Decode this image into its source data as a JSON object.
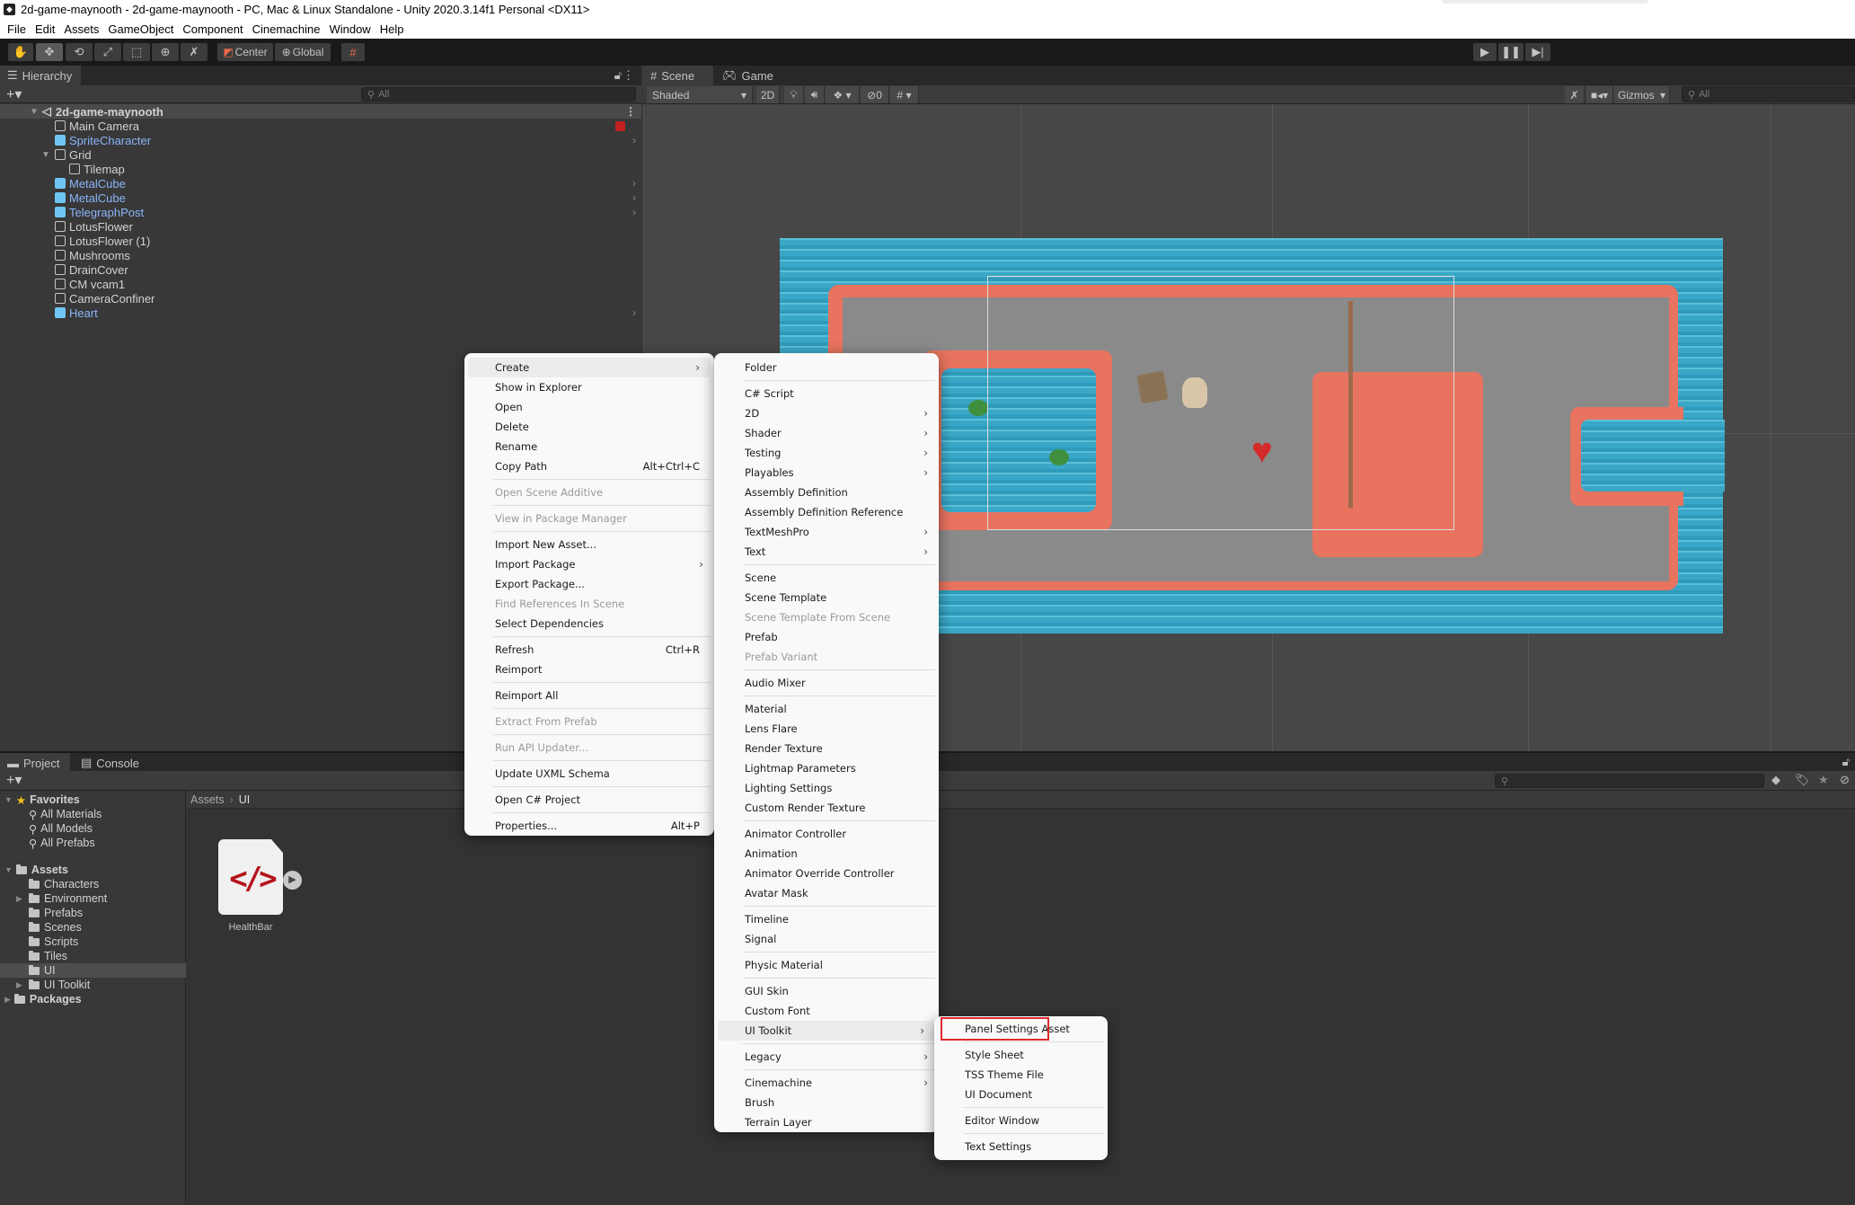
{
  "window": {
    "title": "2d-game-maynooth - 2d-game-maynooth - PC, Mac & Linux Standalone - Unity 2020.3.14f1 Personal <DX11>"
  },
  "menubar": [
    "File",
    "Edit",
    "Assets",
    "GameObject",
    "Component",
    "Cinemachine",
    "Window",
    "Help"
  ],
  "toolbar": {
    "tools": [
      "hand-tool",
      "move-tool",
      "rotate-tool",
      "scale-tool",
      "rect-tool",
      "transform-tool",
      "custom-tool"
    ],
    "pivot_label": "Center",
    "space_label": "Global",
    "snap": "grid-snap",
    "play": "play",
    "pause": "pause",
    "step": "step"
  },
  "hierarchy": {
    "tab_label": "Hierarchy",
    "search_placeholder": "All",
    "scene_name": "2d-game-maynooth",
    "items": [
      {
        "label": "Main Camera",
        "prefab": false,
        "depth": 1
      },
      {
        "label": "SpriteCharacter",
        "prefab": true,
        "depth": 1,
        "has_children": true
      },
      {
        "label": "Grid",
        "prefab": false,
        "depth": 1,
        "expanded": true
      },
      {
        "label": "Tilemap",
        "prefab": false,
        "depth": 2
      },
      {
        "label": "MetalCube",
        "prefab": true,
        "depth": 1,
        "has_children": true
      },
      {
        "label": "MetalCube",
        "prefab": true,
        "depth": 1,
        "has_children": true
      },
      {
        "label": "TelegraphPost",
        "prefab": true,
        "depth": 1,
        "has_children": true
      },
      {
        "label": "LotusFlower",
        "prefab": false,
        "depth": 1
      },
      {
        "label": "LotusFlower (1)",
        "prefab": false,
        "depth": 1
      },
      {
        "label": "Mushrooms",
        "prefab": false,
        "depth": 1
      },
      {
        "label": "DrainCover",
        "prefab": false,
        "depth": 1
      },
      {
        "label": "CM vcam1",
        "prefab": false,
        "depth": 1
      },
      {
        "label": "CameraConfiner",
        "prefab": false,
        "depth": 1
      },
      {
        "label": "Heart",
        "prefab": true,
        "depth": 1,
        "has_children": true
      }
    ]
  },
  "scene_view": {
    "tabs": [
      {
        "label": "Scene",
        "icon": "grid-icon"
      },
      {
        "label": "Game",
        "icon": "gamepad-icon"
      }
    ],
    "shading_mode": "Shaded",
    "mode_2d_label": "2D",
    "hidden_count": "0",
    "gizmos_label": "Gizmos",
    "search_placeholder": "All"
  },
  "project": {
    "tabs": [
      {
        "label": "Project",
        "icon": "folder-icon"
      },
      {
        "label": "Console",
        "icon": "console-icon"
      }
    ],
    "favorites_label": "Favorites",
    "favorites": [
      "All Materials",
      "All Models",
      "All Prefabs"
    ],
    "assets_label": "Assets",
    "folders": [
      {
        "label": "Characters",
        "expandable": false
      },
      {
        "label": "Environment",
        "expandable": true
      },
      {
        "label": "Prefabs",
        "expandable": false
      },
      {
        "label": "Scenes",
        "expandable": false
      },
      {
        "label": "Scripts",
        "expandable": false
      },
      {
        "label": "Tiles",
        "expandable": false
      },
      {
        "label": "UI",
        "expandable": false,
        "selected": true
      },
      {
        "label": "UI Toolkit",
        "expandable": true
      }
    ],
    "packages_label": "Packages",
    "breadcrumb": [
      "Assets",
      "UI"
    ],
    "files": [
      {
        "label": "HealthBar",
        "type": "uxml"
      }
    ]
  },
  "context_menu": {
    "items": [
      {
        "label": "Create",
        "submenu": true,
        "highlighted": true
      },
      {
        "label": "Show in Explorer"
      },
      {
        "label": "Open"
      },
      {
        "label": "Delete"
      },
      {
        "label": "Rename"
      },
      {
        "label": "Copy Path",
        "shortcut": "Alt+Ctrl+C"
      },
      {
        "sep": true
      },
      {
        "label": "Open Scene Additive",
        "disabled": true
      },
      {
        "sep": true
      },
      {
        "label": "View in Package Manager",
        "disabled": true
      },
      {
        "sep": true
      },
      {
        "label": "Import New Asset..."
      },
      {
        "label": "Import Package",
        "submenu": true
      },
      {
        "label": "Export Package..."
      },
      {
        "label": "Find References In Scene",
        "disabled": true
      },
      {
        "label": "Select Dependencies"
      },
      {
        "sep": true
      },
      {
        "label": "Refresh",
        "shortcut": "Ctrl+R"
      },
      {
        "label": "Reimport"
      },
      {
        "sep": true
      },
      {
        "label": "Reimport All"
      },
      {
        "sep": true
      },
      {
        "label": "Extract From Prefab",
        "disabled": true
      },
      {
        "sep": true
      },
      {
        "label": "Run API Updater...",
        "disabled": true
      },
      {
        "sep": true
      },
      {
        "label": "Update UXML Schema"
      },
      {
        "sep": true
      },
      {
        "label": "Open C# Project"
      },
      {
        "sep": true
      },
      {
        "label": "Properties...",
        "shortcut": "Alt+P"
      }
    ]
  },
  "create_menu": {
    "items": [
      {
        "label": "Folder"
      },
      {
        "sep": true
      },
      {
        "label": "C# Script"
      },
      {
        "label": "2D",
        "submenu": true
      },
      {
        "label": "Shader",
        "submenu": true
      },
      {
        "label": "Testing",
        "submenu": true
      },
      {
        "label": "Playables",
        "submenu": true
      },
      {
        "label": "Assembly Definition"
      },
      {
        "label": "Assembly Definition Reference"
      },
      {
        "label": "TextMeshPro",
        "submenu": true
      },
      {
        "label": "Text",
        "submenu": true
      },
      {
        "sep": true
      },
      {
        "label": "Scene"
      },
      {
        "label": "Scene Template"
      },
      {
        "label": "Scene Template From Scene",
        "disabled": true
      },
      {
        "label": "Prefab"
      },
      {
        "label": "Prefab Variant",
        "disabled": true
      },
      {
        "sep": true
      },
      {
        "label": "Audio Mixer"
      },
      {
        "sep": true
      },
      {
        "label": "Material"
      },
      {
        "label": "Lens Flare"
      },
      {
        "label": "Render Texture"
      },
      {
        "label": "Lightmap Parameters"
      },
      {
        "label": "Lighting Settings"
      },
      {
        "label": "Custom Render Texture"
      },
      {
        "sep": true
      },
      {
        "label": "Animator Controller"
      },
      {
        "label": "Animation"
      },
      {
        "label": "Animator Override Controller"
      },
      {
        "label": "Avatar Mask"
      },
      {
        "sep": true
      },
      {
        "label": "Timeline"
      },
      {
        "label": "Signal"
      },
      {
        "sep": true
      },
      {
        "label": "Physic Material"
      },
      {
        "sep": true
      },
      {
        "label": "GUI Skin"
      },
      {
        "label": "Custom Font"
      },
      {
        "label": "UI Toolkit",
        "submenu": true,
        "highlighted": true
      },
      {
        "sep": true
      },
      {
        "label": "Legacy",
        "submenu": true
      },
      {
        "sep": true
      },
      {
        "label": "Cinemachine",
        "submenu": true
      },
      {
        "label": "Brush"
      },
      {
        "label": "Terrain Layer"
      }
    ]
  },
  "ui_toolkit_menu": {
    "items": [
      {
        "label": "Panel Settings Asset",
        "annotated": true
      },
      {
        "sep": true
      },
      {
        "label": "Style Sheet"
      },
      {
        "label": "TSS Theme File"
      },
      {
        "label": "UI Document"
      },
      {
        "sep": true
      },
      {
        "label": "Editor Window"
      },
      {
        "sep": true
      },
      {
        "label": "Text Settings"
      }
    ]
  },
  "colors": {
    "annotation_box": "#e0282e",
    "prefab_text": "#8ab4f8",
    "uxml_icon": "#b5121b"
  }
}
